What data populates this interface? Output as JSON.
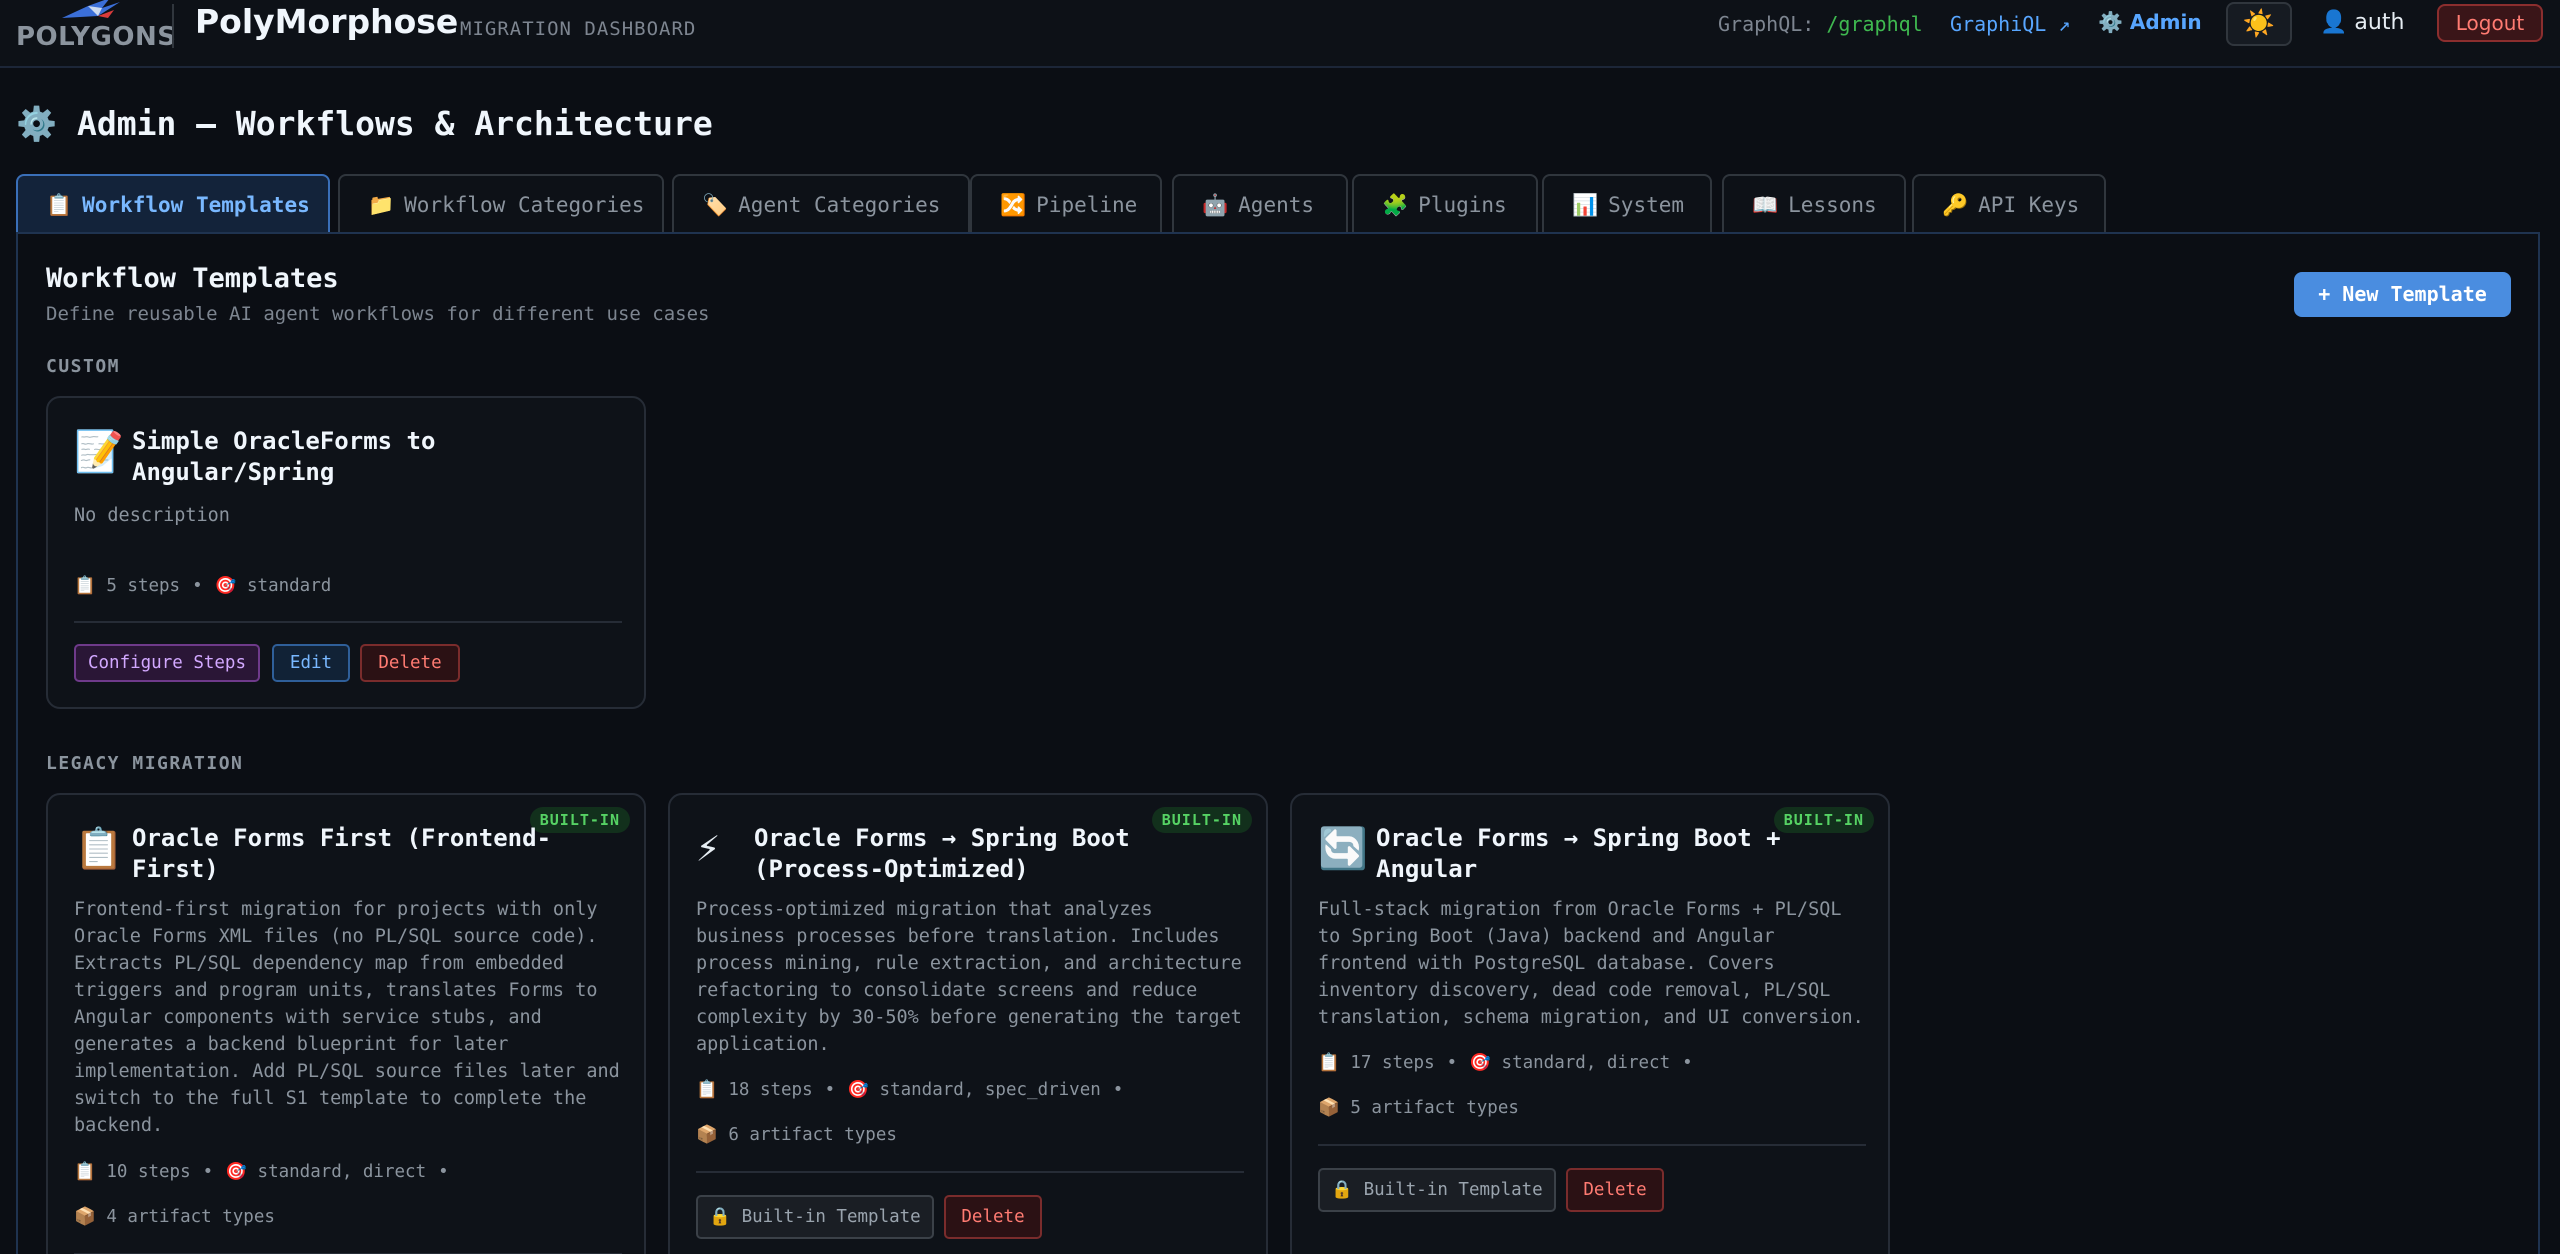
{
  "brand": {
    "logo_text": "POLYGONS",
    "app_name": "PolyMorphose",
    "subtitle": "MIGRATION DASHBOARD"
  },
  "header": {
    "graphql_label": "GraphQL:",
    "graphql_path": "/graphql",
    "graphiql_link": "GraphiQL ↗",
    "admin_icon": "⚙️",
    "admin_label": "Admin",
    "theme_icon": "☀️",
    "user_icon": "👤",
    "user_name": "auth",
    "logout_label": "Logout"
  },
  "page": {
    "icon": "⚙️",
    "title": "Admin — Workflows & Architecture"
  },
  "tabs": [
    {
      "icon": "📋",
      "label": "Workflow Templates",
      "active": true
    },
    {
      "icon": "📁",
      "label": "Workflow Categories"
    },
    {
      "icon": "🏷️",
      "label": "Agent Categories"
    },
    {
      "icon": "🔀",
      "label": "Pipeline"
    },
    {
      "icon": "🤖",
      "label": "Agents"
    },
    {
      "icon": "🧩",
      "label": "Plugins"
    },
    {
      "icon": "📊",
      "label": "System"
    },
    {
      "icon": "📖",
      "label": "Lessons"
    },
    {
      "icon": "🔑",
      "label": "API Keys"
    }
  ],
  "section": {
    "title": "Workflow Templates",
    "subtitle": "Define reusable AI agent workflows for different use cases",
    "new_button": "+ New Template"
  },
  "groups": [
    {
      "label": "CUSTOM",
      "cards": [
        {
          "icon": "📝",
          "title": "Simple OracleForms to Angular/Spring",
          "description": "No description",
          "steps_icon": "📋",
          "steps": "5 steps",
          "modes_icon": "🎯",
          "modes": "standard",
          "buttons": [
            "Configure Steps",
            "Edit",
            "Delete"
          ]
        }
      ]
    },
    {
      "label": "LEGACY MIGRATION",
      "cards": [
        {
          "icon": "📋",
          "badge": "BUILT-IN",
          "title": "Oracle Forms First (Frontend-First)",
          "description": "Frontend-first migration for projects with only Oracle Forms XML files (no PL/SQL source code). Extracts PL/SQL dependency map from embedded triggers and program units, translates Forms to Angular components with service stubs, and generates a backend blueprint for later implementation. Add PL/SQL source files later and switch to the full S1 template to complete the backend.",
          "steps_icon": "📋",
          "steps": "10 steps",
          "modes_icon": "🎯",
          "modes": "standard, direct",
          "artifacts_icon": "📦",
          "artifacts": "4 artifact types"
        },
        {
          "icon": "⚡",
          "badge": "BUILT-IN",
          "title": "Oracle Forms → Spring Boot (Process-Optimized)",
          "description": "Process-optimized migration that analyzes business processes before translation. Includes process mining, rule extraction, and architecture refactoring to consolidate screens and reduce complexity by 30-50% before generating the target application.",
          "steps_icon": "📋",
          "steps": "18 steps",
          "modes_icon": "🎯",
          "modes": "standard, spec_driven",
          "artifacts_icon": "📦",
          "artifacts": "6 artifact types",
          "builtin_button": "🔒 Built-in Template",
          "delete_button": "Delete"
        },
        {
          "icon": "🔄",
          "badge": "BUILT-IN",
          "title": "Oracle Forms → Spring Boot + Angular",
          "description": "Full-stack migration from Oracle Forms + PL/SQL to Spring Boot (Java) backend and Angular frontend with PostgreSQL database. Covers inventory discovery, dead code removal, PL/SQL translation, schema migration, and UI conversion.",
          "steps_icon": "📋",
          "steps": "17 steps",
          "modes_icon": "🎯",
          "modes": "standard, direct",
          "artifacts_icon": "📦",
          "artifacts": "5 artifact types",
          "builtin_button": "🔒 Built-in Template",
          "delete_button": "Delete"
        }
      ]
    }
  ],
  "colors": {
    "accent": "#4a8de0",
    "background": "#0b0e14",
    "badge_green": "#56d364",
    "danger": "#ff7b72"
  }
}
